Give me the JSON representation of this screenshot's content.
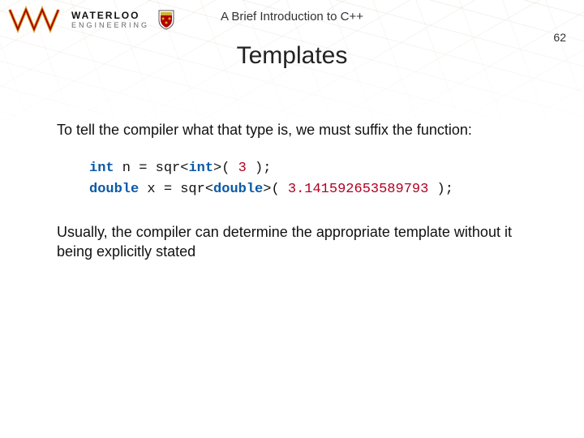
{
  "logo": {
    "line1": "WATERLOO",
    "line2": "ENGINEERING"
  },
  "doc_title": "A Brief Introduction to C++",
  "page_number": "62",
  "slide_title": "Templates",
  "paragraph1": "To tell the compiler what that type is, we must suffix the function:",
  "code": {
    "kw_int": "int",
    "l1_a": " n = sqr<",
    "l1_b": ">( ",
    "l1_num": "3",
    "l1_c": " );",
    "kw_double": "double",
    "l2_a": " x = sqr<",
    "l2_b": ">( ",
    "l2_num": "3.141592653589793",
    "l2_c": " );"
  },
  "paragraph2": "Usually, the compiler can determine the appropriate template without it being explicitly stated"
}
